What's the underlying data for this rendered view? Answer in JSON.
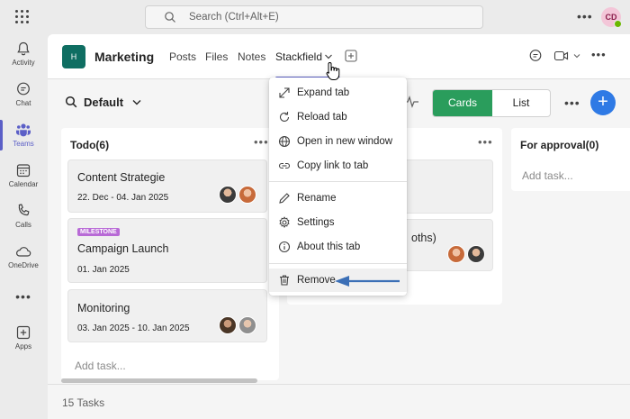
{
  "search": {
    "placeholder": "Search (Ctrl+Alt+E)"
  },
  "user": {
    "initials": "CD"
  },
  "rail": [
    {
      "label": "Activity"
    },
    {
      "label": "Chat"
    },
    {
      "label": "Teams"
    },
    {
      "label": "Calendar"
    },
    {
      "label": "Calls"
    },
    {
      "label": "OneDrive"
    },
    {
      "label": "Apps"
    }
  ],
  "channel": {
    "badge": "H",
    "name": "Marketing",
    "tabs": [
      "Posts",
      "Files",
      "Notes",
      "Stackfield"
    ]
  },
  "board": {
    "view_name": "Default",
    "view_cards": "Cards",
    "view_list": "List"
  },
  "columns": [
    {
      "title": "Todo(6)",
      "cards": [
        {
          "title": "Content Strategie",
          "date": "22. Dec - 04. Jan 2025"
        },
        {
          "badge": "MILESTONE",
          "title": "Campaign Launch",
          "date": "01. Jan 2025"
        },
        {
          "title": "Monitoring",
          "date": "03. Jan 2025 - 10. Jan 2025"
        }
      ],
      "add_task": "Add task..."
    },
    {
      "cards": [
        {
          "title_fragment": "oths)"
        }
      ]
    },
    {
      "title": "For approval(0)",
      "add_task": "Add task..."
    }
  ],
  "menu": {
    "items": [
      {
        "label": "Expand tab",
        "icon": "expand-icon"
      },
      {
        "label": "Reload tab",
        "icon": "reload-icon"
      },
      {
        "label": "Open in new window",
        "icon": "globe-icon"
      },
      {
        "label": "Copy link to tab",
        "icon": "link-icon"
      },
      {
        "label": "Rename",
        "icon": "pencil-icon"
      },
      {
        "label": "Settings",
        "icon": "gear-icon"
      },
      {
        "label": "About this tab",
        "icon": "info-icon"
      },
      {
        "label": "Remove",
        "icon": "trash-icon"
      }
    ]
  },
  "footer": {
    "tasks": "15 Tasks"
  },
  "colors": {
    "accent": "#5b5fc7",
    "cards_green": "#2a9d5c",
    "plus_blue": "#2f7ae5",
    "milestone": "#b86ad6",
    "arrow": "#3b6fb6"
  }
}
